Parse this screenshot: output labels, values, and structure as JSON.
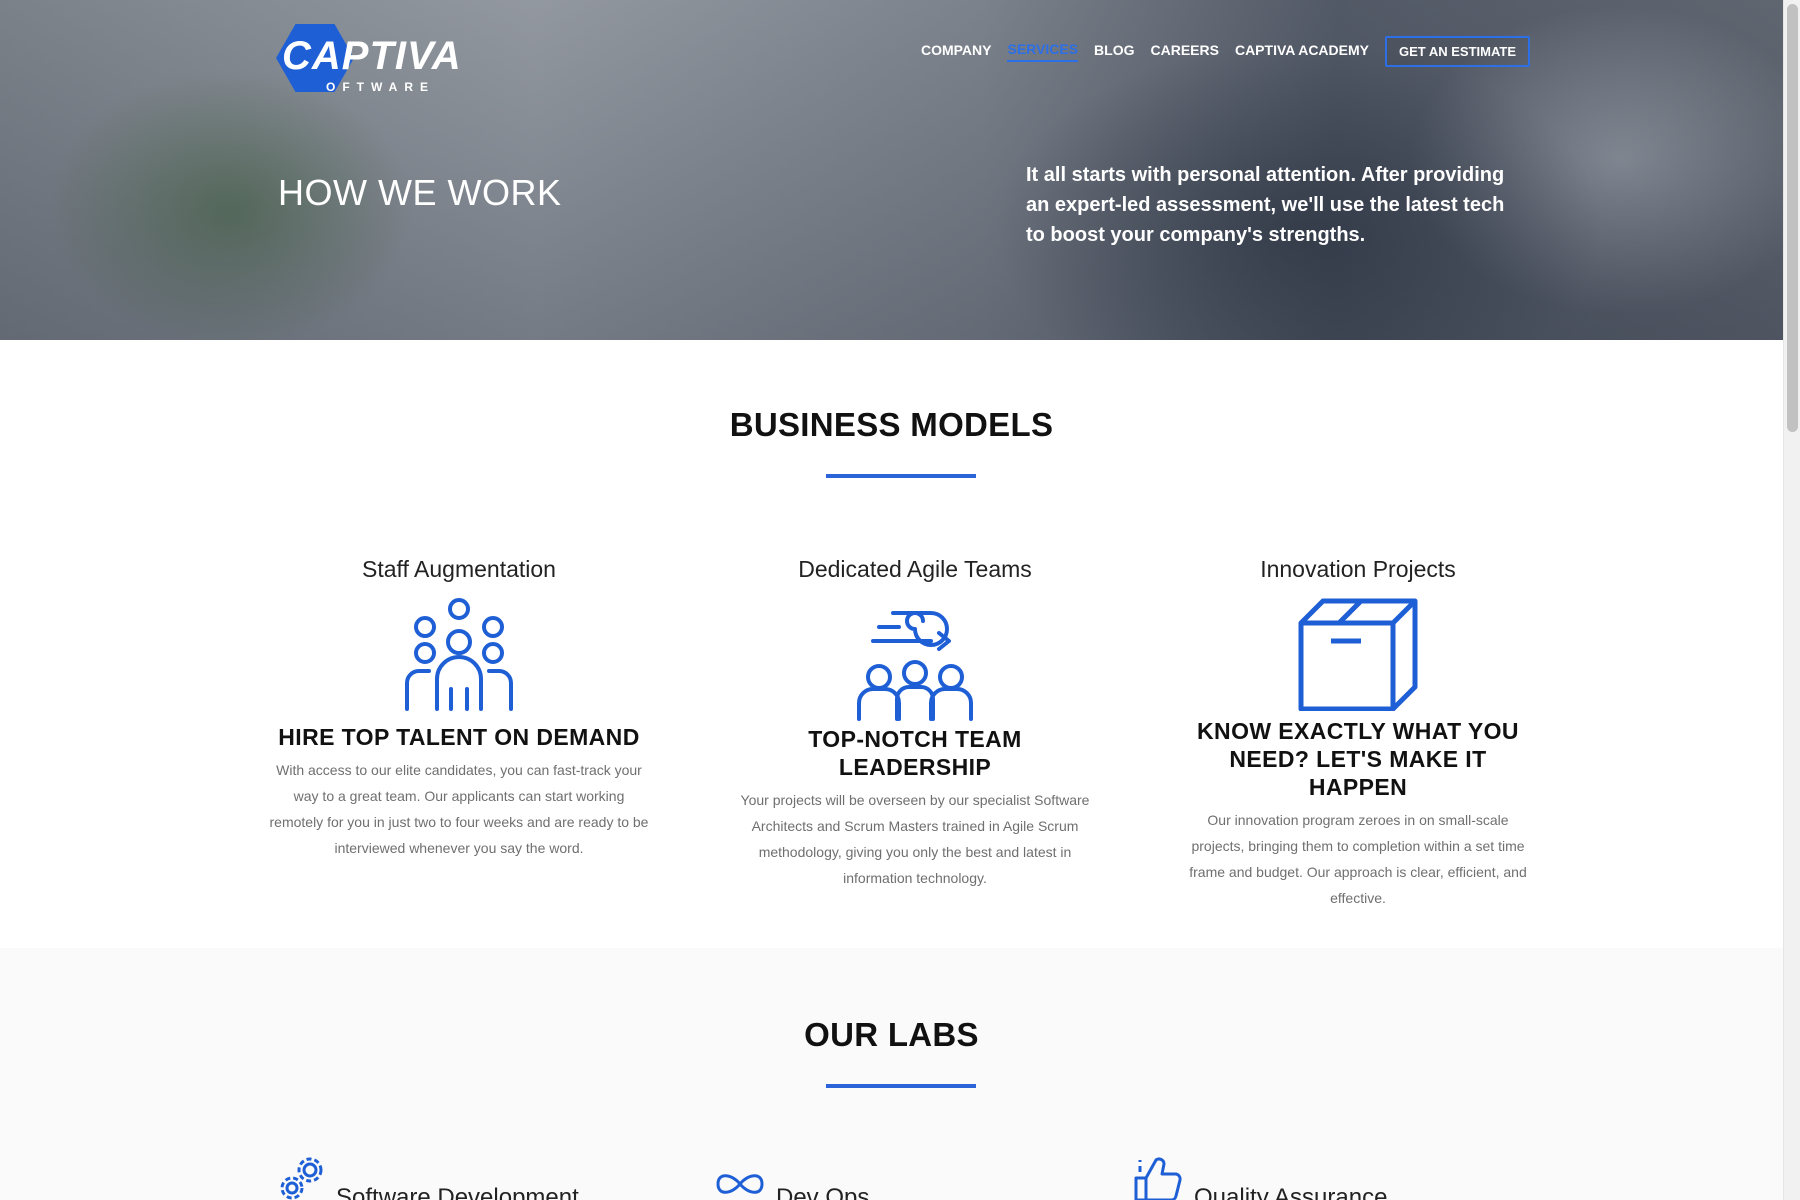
{
  "brand": {
    "logo_word": "CAPTIVA",
    "logo_sub": "OFTWARE"
  },
  "nav": {
    "items": [
      "COMPANY",
      "SERVICES",
      "BLOG",
      "CAREERS",
      "CAPTIVA ACADEMY"
    ],
    "active": "SERVICES",
    "cta": "GET AN ESTIMATE"
  },
  "hero": {
    "title": "HOW WE WORK",
    "text": "It all starts with personal attention. After providing an expert-led assessment, we'll use the latest tech to boost your company's strengths."
  },
  "business_models": {
    "title": "BUSINESS MODELS",
    "items": [
      {
        "name": "Staff Augmentation",
        "icon": "team-group-icon",
        "heading": "HIRE TOP TALENT ON DEMAND",
        "text": "With access to our elite candidates, you can fast-track your way to a great team. Our applicants can start working remotely for you in just two to four weeks and are ready to be interviewed whenever you say the word."
      },
      {
        "name": "Dedicated Agile Teams",
        "icon": "agile-team-icon",
        "heading": "TOP-NOTCH TEAM LEADERSHIP",
        "text": "Your projects will be overseen by our specialist Software Architects and Scrum Masters trained in Agile Scrum methodology, giving you only the best and latest in information technology."
      },
      {
        "name": "Innovation Projects",
        "icon": "box-icon",
        "heading": "KNOW EXACTLY WHAT YOU NEED? LET'S MAKE IT HAPPEN",
        "text": "Our innovation program zeroes in on small-scale projects, bringing them to completion within a set time frame and budget. Our approach is clear, efficient, and effective."
      }
    ]
  },
  "labs": {
    "title": "OUR LABS",
    "items": [
      {
        "name": "Software Development",
        "icon": "gears-icon"
      },
      {
        "name": "Dev Ops",
        "icon": "infinity-icon"
      },
      {
        "name": "Quality Assurance",
        "icon": "thumbs-up-icon"
      }
    ]
  },
  "colors": {
    "accent": "#2b64d8",
    "hero_text": "#ffffff",
    "body_text": "#6f6f6f"
  }
}
